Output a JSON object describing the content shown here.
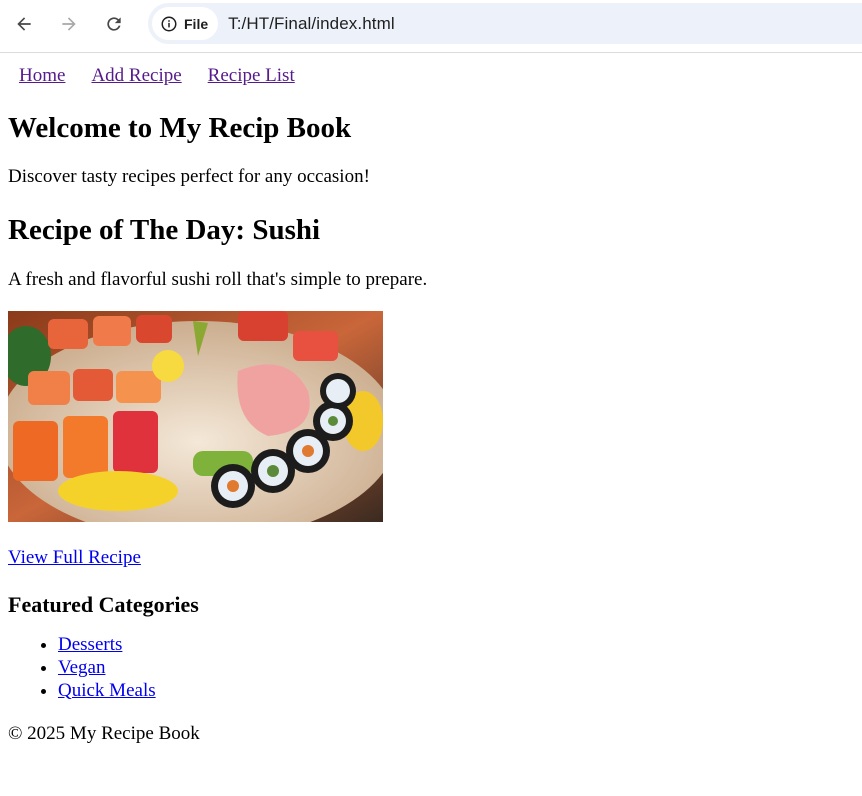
{
  "browser": {
    "back_icon": "arrow-left-icon",
    "forward_icon": "arrow-right-icon",
    "reload_icon": "reload-icon",
    "site_info_label": "File",
    "url": "T:/HT/Final/index.html"
  },
  "nav": {
    "items": [
      {
        "label": "Home"
      },
      {
        "label": "Add Recipe"
      },
      {
        "label": "Recipe List"
      }
    ]
  },
  "main": {
    "title": "Welcome to My Recip Book",
    "intro": "Discover tasty recipes perfect for any occasion!",
    "recipe_title": "Recipe of The Day: Sushi",
    "recipe_desc": "A fresh and flavorful sushi roll that's simple to prepare.",
    "view_link": "View Full Recipe"
  },
  "categories": {
    "heading": "Featured Categories",
    "items": [
      {
        "label": "Desserts"
      },
      {
        "label": "Vegan"
      },
      {
        "label": "Quick Meals"
      }
    ]
  },
  "footer": {
    "text": "© 2025 My Recipe Book"
  },
  "colors": {
    "visited_link": "#551a8b",
    "link": "#0000ee",
    "omnibox_bg": "#edf2fa"
  }
}
